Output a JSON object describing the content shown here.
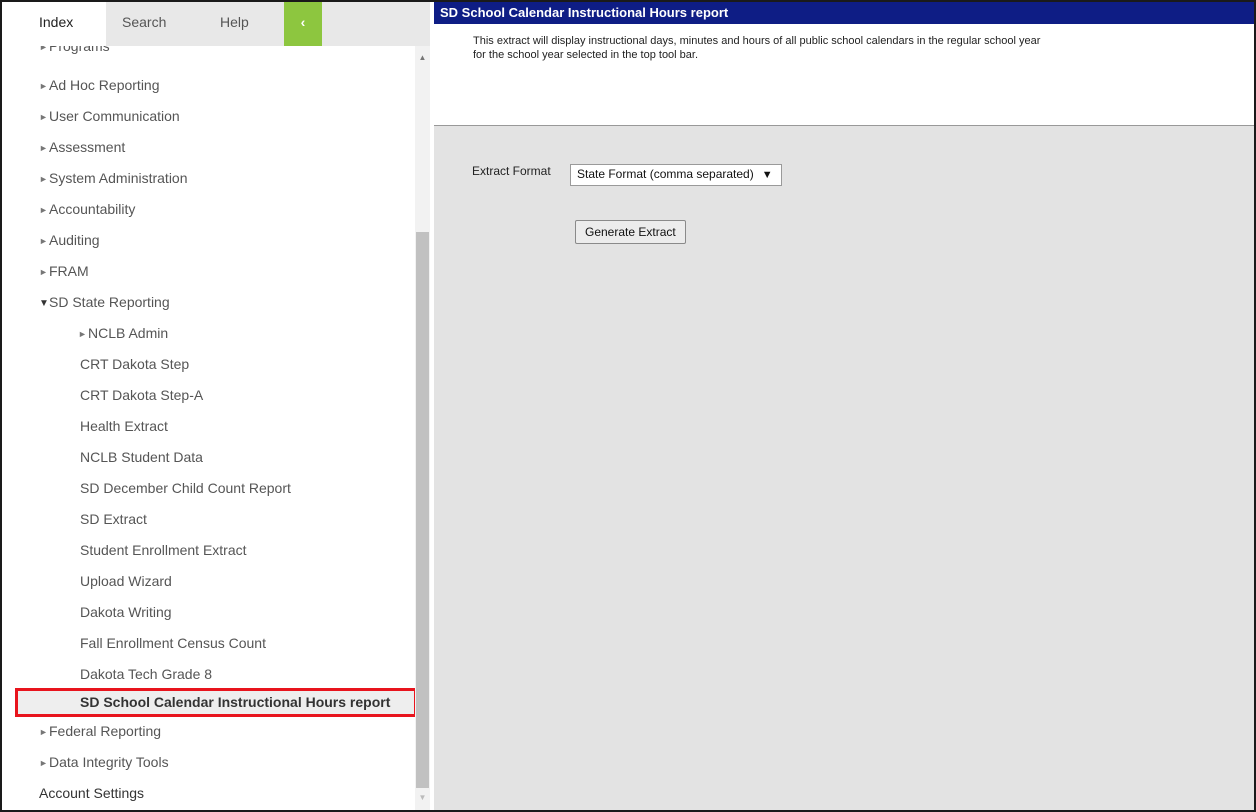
{
  "tabs": {
    "index": "Index",
    "search": "Search",
    "help": "Help",
    "collapse": "‹"
  },
  "tree": {
    "partial_top": "Programs",
    "items": [
      {
        "label": "Ad Hoc Reporting"
      },
      {
        "label": "User Communication"
      },
      {
        "label": "Assessment"
      },
      {
        "label": "System Administration"
      },
      {
        "label": "Accountability"
      },
      {
        "label": "Auditing"
      },
      {
        "label": "FRAM"
      },
      {
        "label": "SD State Reporting"
      }
    ],
    "sd_children": [
      {
        "label": "NCLB Admin"
      },
      {
        "label": "CRT Dakota Step"
      },
      {
        "label": "CRT Dakota Step-A"
      },
      {
        "label": "Health Extract"
      },
      {
        "label": "NCLB Student Data"
      },
      {
        "label": "SD December Child Count Report"
      },
      {
        "label": "SD Extract"
      },
      {
        "label": "Student Enrollment Extract"
      },
      {
        "label": "Upload Wizard"
      },
      {
        "label": "Dakota Writing"
      },
      {
        "label": "Fall Enrollment Census Count"
      },
      {
        "label": "Dakota Tech Grade 8"
      },
      {
        "label": "SD School Calendar Instructional Hours report"
      }
    ],
    "bottom_items": [
      {
        "label": "Federal Reporting"
      },
      {
        "label": "Data Integrity Tools"
      }
    ],
    "account_settings": "Account Settings"
  },
  "main": {
    "title": "SD School Calendar Instructional Hours report",
    "description_line1": "This extract will display instructional days, minutes and hours of all public school calendars in the regular school year",
    "description_line2": "for the school year selected in the top tool bar.",
    "extract_format_label": "Extract Format",
    "extract_format_value": "State Format (comma separated)",
    "generate_button": "Generate Extract"
  },
  "colors": {
    "header_bg": "#0e1d85",
    "collapse_tab": "#8dc63f",
    "highlight_border": "#e8141d"
  }
}
